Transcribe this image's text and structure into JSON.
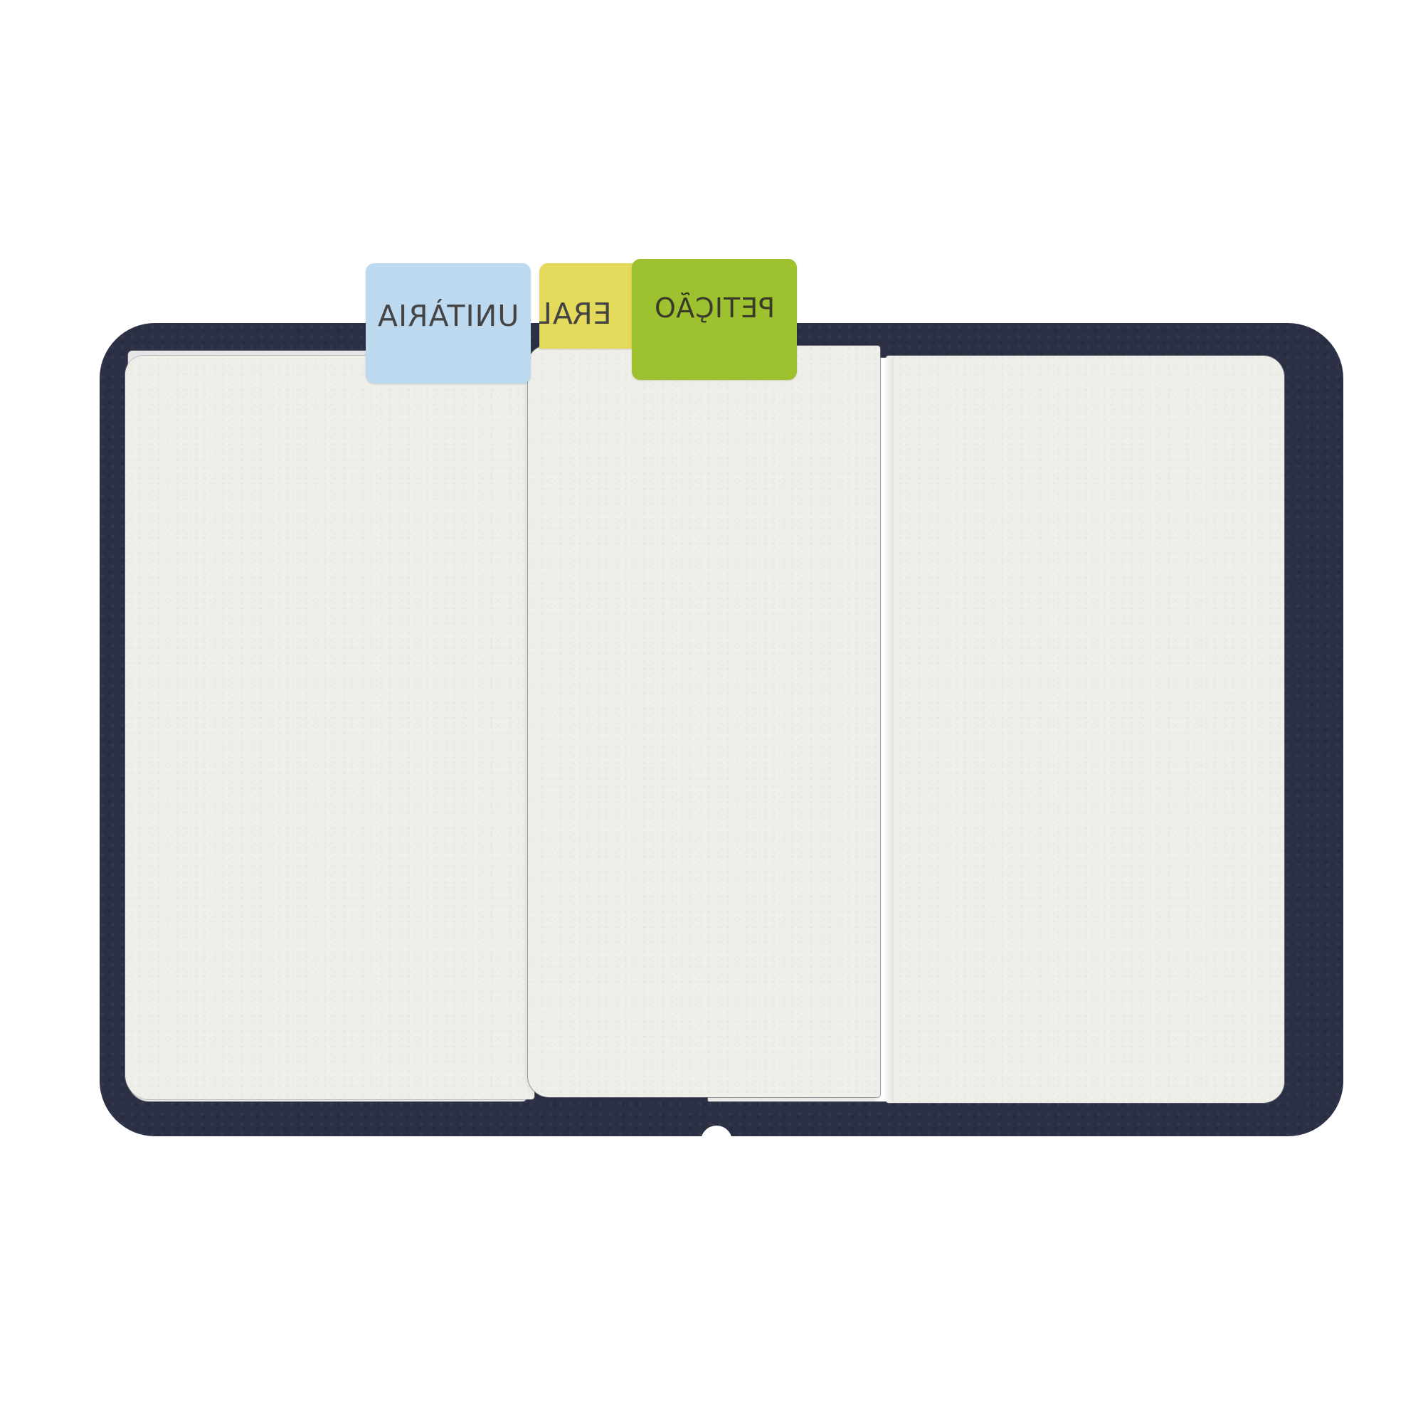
{
  "tabs": [
    {
      "label": "UNITÀRIA",
      "color": "#bcd9ef"
    },
    {
      "label": "GERAL",
      "visible_text": "ERAL",
      "color": "#e3d95a"
    },
    {
      "label": "PETIÇÃO",
      "color": "#9dc12f"
    }
  ],
  "cover": {
    "color": "#2c3045"
  },
  "paper": {
    "color": "#efefea"
  }
}
